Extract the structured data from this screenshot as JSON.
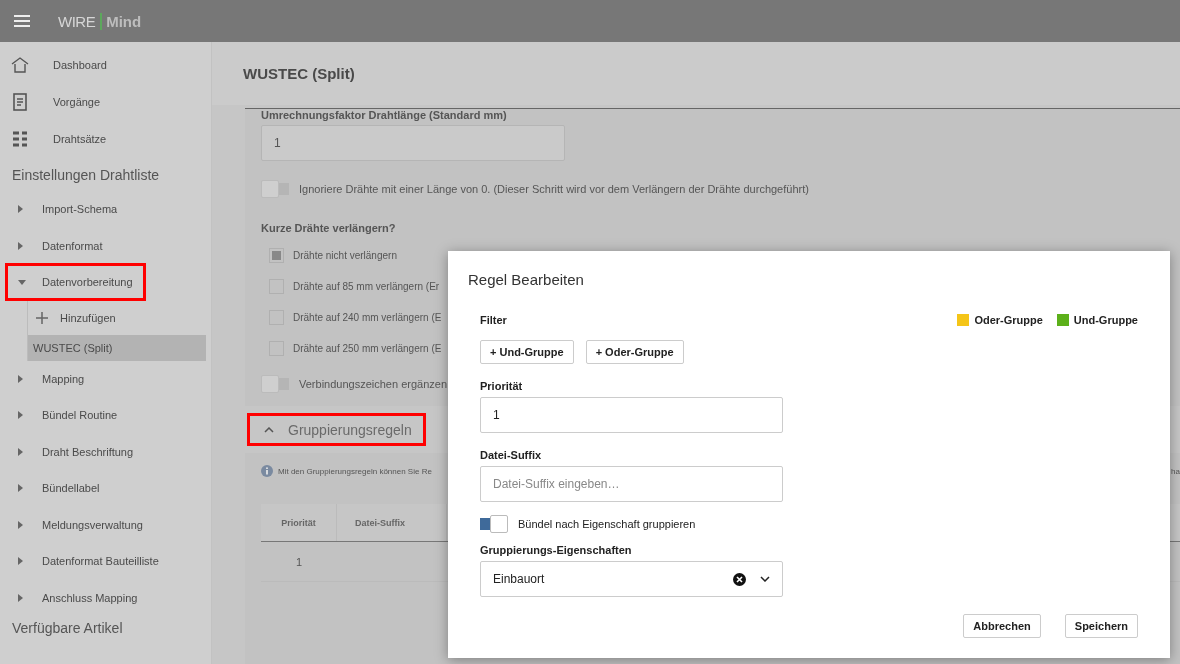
{
  "app_bar": {
    "logo_left": "WIRE",
    "logo_right": "Mind"
  },
  "sidebar": {
    "nav": [
      {
        "label": "Dashboard",
        "kind": "home"
      },
      {
        "label": "Vorgänge",
        "kind": "doc"
      },
      {
        "label": "Drahtsätze",
        "kind": "list"
      }
    ],
    "section_title": "Einstellungen Drahtliste",
    "tree": [
      {
        "label": "Import-Schema",
        "expanded": false,
        "highlighted": false
      },
      {
        "label": "Datenformat",
        "expanded": false,
        "highlighted": false
      },
      {
        "label": "Datenvorbereitung",
        "expanded": true,
        "highlighted": true,
        "children": [
          {
            "label": "Hinzufügen",
            "kind": "add",
            "selected": false
          },
          {
            "label": "WUSTEC (Split)",
            "kind": "item",
            "selected": true
          }
        ]
      },
      {
        "label": "Mapping",
        "expanded": false,
        "highlighted": false
      },
      {
        "label": "Bündel Routine",
        "expanded": false,
        "highlighted": false
      },
      {
        "label": "Draht Beschriftung",
        "expanded": false,
        "highlighted": false
      },
      {
        "label": "Bündellabel",
        "expanded": false,
        "highlighted": false
      },
      {
        "label": "Meldungsverwaltung",
        "expanded": false,
        "highlighted": false
      },
      {
        "label": "Datenformat Bauteilliste",
        "expanded": false,
        "highlighted": false
      },
      {
        "label": "Anschluss Mapping",
        "expanded": false,
        "highlighted": false
      }
    ],
    "footer_title": "Verfügbare Artikel"
  },
  "page": {
    "title": "WUSTEC (Split)",
    "settings": {
      "factor_label": "Umrechnungsfaktor Drahtlänge (Standard mm)",
      "factor_value": "1",
      "ignore_toggle": {
        "label": "Ignoriere Drähte mit einer Länge von 0. (Dieser Schritt wird vor dem Verlängern der Drähte durchgeführt)",
        "on": false
      },
      "extend_title": "Kurze Drähte verlängern?",
      "extend_options": [
        {
          "label": "Drähte nicht verlängern",
          "checked": true
        },
        {
          "label": "Drähte auf 85 mm verlängern (Er",
          "checked": false
        },
        {
          "label": "Drähte auf 240 mm verlängern (E",
          "checked": false
        },
        {
          "label": "Drähte auf 250 mm verlängern (E",
          "checked": false
        }
      ],
      "connector_toggle": {
        "label": "Verbindungszeichen ergänzen",
        "on": false
      }
    },
    "grouping": {
      "title": "Gruppierungsregeln",
      "expanded": true,
      "highlighted": true,
      "info": "Mit den Gruppierungsregeln können Sie Re",
      "info_tail": "ha",
      "table": {
        "columns": [
          "Priorität",
          "Datei-Suffix"
        ],
        "rows": [
          {
            "cells": [
              "1"
            ]
          }
        ]
      }
    }
  },
  "dialog": {
    "title": "Regel Bearbeiten",
    "filter_label": "Filter",
    "legend": [
      {
        "label": "Oder-Gruppe",
        "color": "#f5c518"
      },
      {
        "label": "Und-Gruppe",
        "color": "#5cb01a"
      }
    ],
    "add_buttons": [
      "+ Und-Gruppe",
      "+ Oder-Gruppe"
    ],
    "priority": {
      "label": "Priorität",
      "value": "1"
    },
    "suffix": {
      "label": "Datei-Suffix",
      "placeholder": "Datei-Suffix eingeben…"
    },
    "group_toggle": {
      "label": "Bündel nach Eigenschaft gruppieren",
      "on": true
    },
    "properties": {
      "label": "Gruppierungs-Eigenschaften",
      "value": "Einbauort"
    },
    "buttons": [
      "Abbrechen",
      "Speichern"
    ]
  }
}
